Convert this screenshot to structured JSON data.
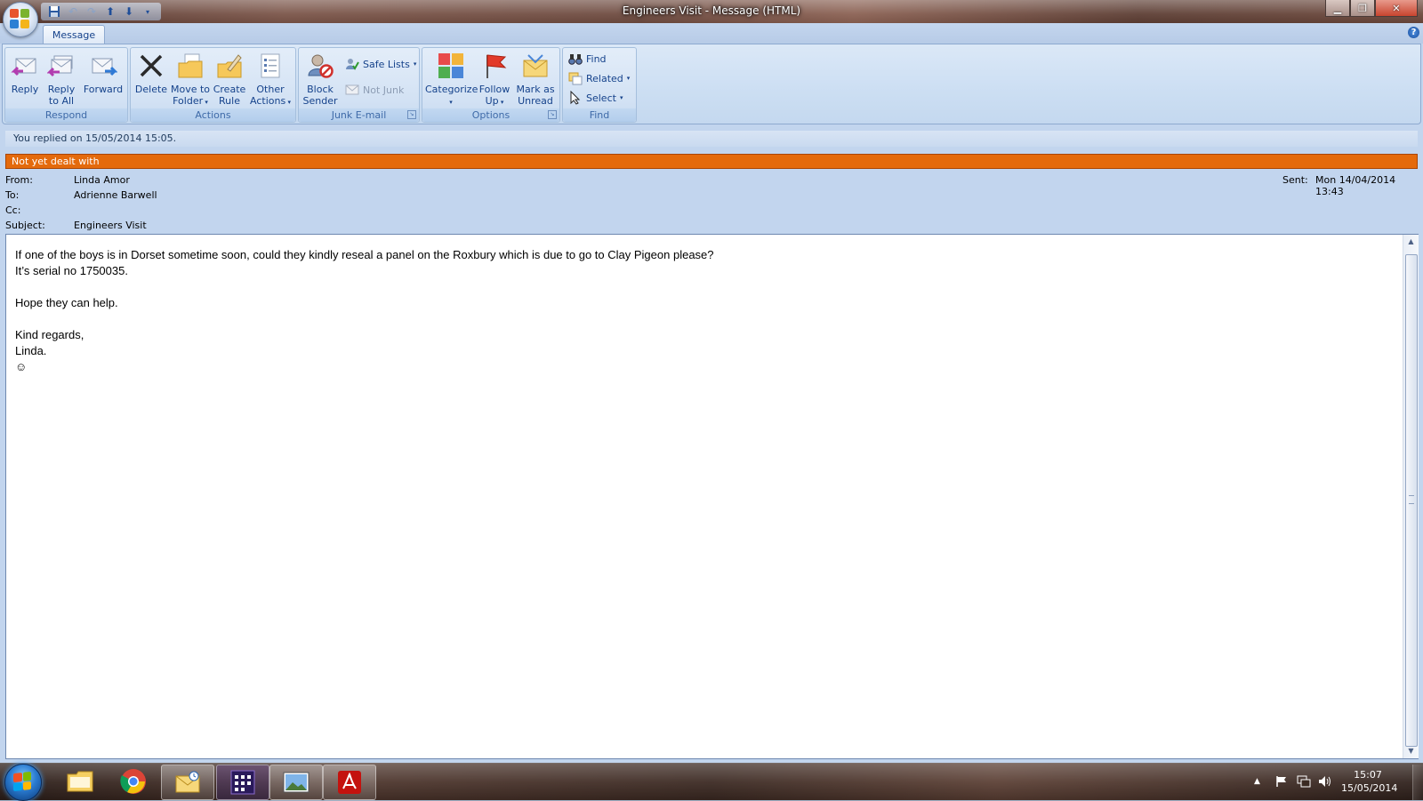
{
  "window": {
    "title": "Engineers Visit - Message (HTML)",
    "controls": [
      "minimize",
      "restore",
      "close"
    ]
  },
  "ribbon": {
    "tab": "Message",
    "groups": {
      "respond": {
        "label": "Respond",
        "reply": "Reply",
        "reply_all_1": "Reply",
        "reply_all_2": "to All",
        "forward": "Forward"
      },
      "actions": {
        "label": "Actions",
        "delete": "Delete",
        "move_1": "Move to",
        "move_2": "Folder",
        "rule_1": "Create",
        "rule_2": "Rule",
        "other_1": "Other",
        "other_2": "Actions"
      },
      "junk": {
        "label": "Junk E-mail",
        "block_1": "Block",
        "block_2": "Sender",
        "safe_lists": "Safe Lists",
        "not_junk": "Not Junk"
      },
      "options": {
        "label": "Options",
        "categorize": "Categorize",
        "follow_1": "Follow",
        "follow_2": "Up",
        "mark_1": "Mark as",
        "mark_2": "Unread"
      },
      "find": {
        "label": "Find",
        "find": "Find",
        "related": "Related",
        "select": "Select"
      }
    }
  },
  "infobar": "You replied on 15/05/2014 15:05.",
  "flag_status": "Not yet dealt with",
  "header": {
    "from_label": "From:",
    "from": "Linda Amor",
    "to_label": "To:",
    "to": "Adrienne Barwell",
    "cc_label": "Cc:",
    "cc": "",
    "subject_label": "Subject:",
    "subject": "Engineers Visit",
    "sent_label": "Sent:",
    "sent": "Mon 14/04/2014 13:43"
  },
  "body": {
    "lines": [
      "If one of the boys is in Dorset sometime soon, could they kindly reseal a panel on the Roxbury which is due to go to Clay Pigeon please?",
      "It’s serial no 1750035.",
      "",
      "Hope they can help.",
      "",
      "Kind regards,",
      "Linda.",
      "☺"
    ]
  },
  "taskbar": {
    "apps": [
      "windows-explorer",
      "google-chrome",
      "outlook",
      "calendar-app",
      "photo-viewer",
      "adobe-reader"
    ],
    "clock_time": "15:07",
    "clock_date": "15/05/2014"
  },
  "colors": {
    "flag_bar": "#e46a0c",
    "ribbon_label": "#3e6aa8",
    "ribbon_text": "#15428b"
  }
}
